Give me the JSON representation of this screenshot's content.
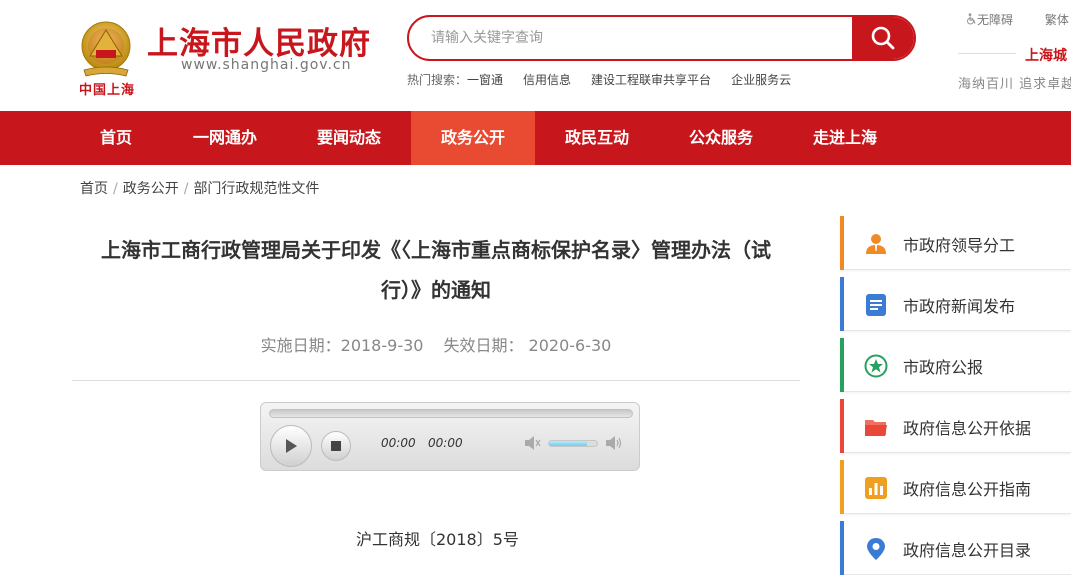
{
  "header": {
    "site_title": "上海市人民政府",
    "site_url": "www.shanghai.gov.cn",
    "logo_caption": "中国上海",
    "search": {
      "placeholder": "请输入关键字查询"
    },
    "hot_label": "热门搜索：",
    "hot_links": [
      "一窗通",
      "信用信息",
      "建设工程联审共享平台",
      "企业服务云"
    ],
    "top_links": {
      "accessibility": "无障碍",
      "traditional": "繁体"
    },
    "city_title": "上海城",
    "city_slogan": "海纳百川 追求卓越"
  },
  "nav": {
    "items": [
      "首页",
      "一网通办",
      "要闻动态",
      "政务公开",
      "政民互动",
      "公众服务",
      "走进上海"
    ],
    "active_index": 3
  },
  "breadcrumb": [
    "首页",
    "政务公开",
    "部门行政规范性文件"
  ],
  "article": {
    "title_line1": "上海市工商行政管理局关于印发《〈上海市重点商标保护名录〉管理办法（试",
    "title_line2": "行）》的通知",
    "effective_date": "实施日期：2018-9-30",
    "expiry_date": "失效日期： 2020-6-30",
    "document_number": "沪工商规〔2018〕5号"
  },
  "player": {
    "current_time": "00:00",
    "duration": "00:00",
    "volume": 0.8
  },
  "sidebar": {
    "items": [
      {
        "label": "市政府领导分工",
        "icon": "leader-icon",
        "color": "#f08a24"
      },
      {
        "label": "市政府新闻发布",
        "icon": "news-doc-icon",
        "color": "#3b7bd4"
      },
      {
        "label": "市政府公报",
        "icon": "star-icon",
        "color": "#27a060"
      },
      {
        "label": "政府信息公开依据",
        "icon": "folder-icon",
        "color": "#e8473a"
      },
      {
        "label": "政府信息公开指南",
        "icon": "chart-icon",
        "color": "#f0a020"
      },
      {
        "label": "政府信息公开目录",
        "icon": "location-icon",
        "color": "#3b7bd4"
      }
    ]
  },
  "colors": {
    "brand": "#c8161d",
    "nav_active": "#e84a32"
  }
}
